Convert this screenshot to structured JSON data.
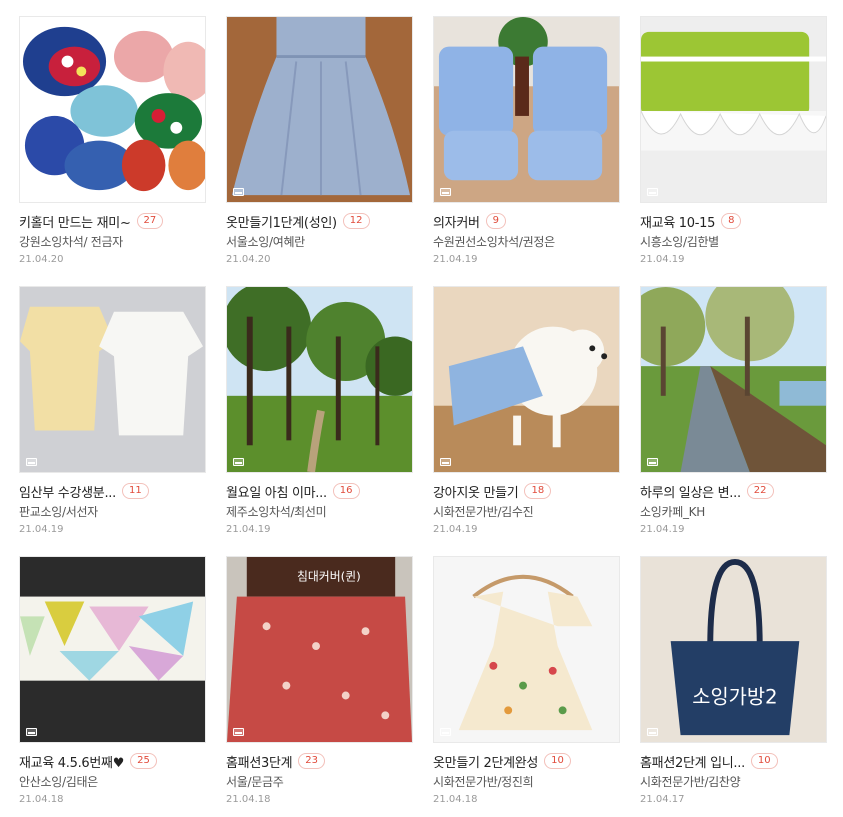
{
  "icons": {
    "image_indicator": "image-icon"
  },
  "colors": {
    "badge_text": "#e14b3b",
    "badge_border": "#f3c1bb",
    "title": "#222222",
    "author": "#555555",
    "date": "#9a9a9a"
  },
  "posts": [
    {
      "title": "키홀더 만드는 재미~",
      "count": "27",
      "author": "강원소잉차석/ 전금자",
      "date": "21.04.20"
    },
    {
      "title": "옷만들기1단계(성인)",
      "count": "12",
      "author": "서울소잉/여혜란",
      "date": "21.04.20"
    },
    {
      "title": "의자커버",
      "count": "9",
      "author": "수원권선소잉차석/권정은",
      "date": "21.04.19"
    },
    {
      "title": "재교육 10-15",
      "count": "8",
      "author": "시흥소잉/김한별",
      "date": "21.04.19"
    },
    {
      "title": "임산부 수강생분...",
      "count": "11",
      "author": "판교소잉/서선자",
      "date": "21.04.19"
    },
    {
      "title": "월요일 아침 이마...",
      "count": "16",
      "author": "제주소잉차석/최선미",
      "date": "21.04.19"
    },
    {
      "title": "강아지옷 만들기",
      "count": "18",
      "author": "시화전문가반/김수진",
      "date": "21.04.19"
    },
    {
      "title": "하루의 일상은 변...",
      "count": "22",
      "author": "소잉카페_KH",
      "date": "21.04.19"
    },
    {
      "title": "재교육 4.5.6번째♥",
      "count": "25",
      "author": "안산소잉/김태은",
      "date": "21.04.18"
    },
    {
      "title": "홈패션3단계",
      "count": "23",
      "author": "서울/문금주",
      "date": "21.04.18"
    },
    {
      "title": "옷만들기 2단계완성",
      "count": "10",
      "author": "시화전문가반/정진희",
      "date": "21.04.18"
    },
    {
      "title": "홈패션2단계 입니...",
      "count": "10",
      "author": "시화전문가반/김찬양",
      "date": "21.04.17"
    }
  ],
  "image_text": {
    "bed_cover": "침대커버(퀸)",
    "tote_bag": "소잉가방2"
  }
}
